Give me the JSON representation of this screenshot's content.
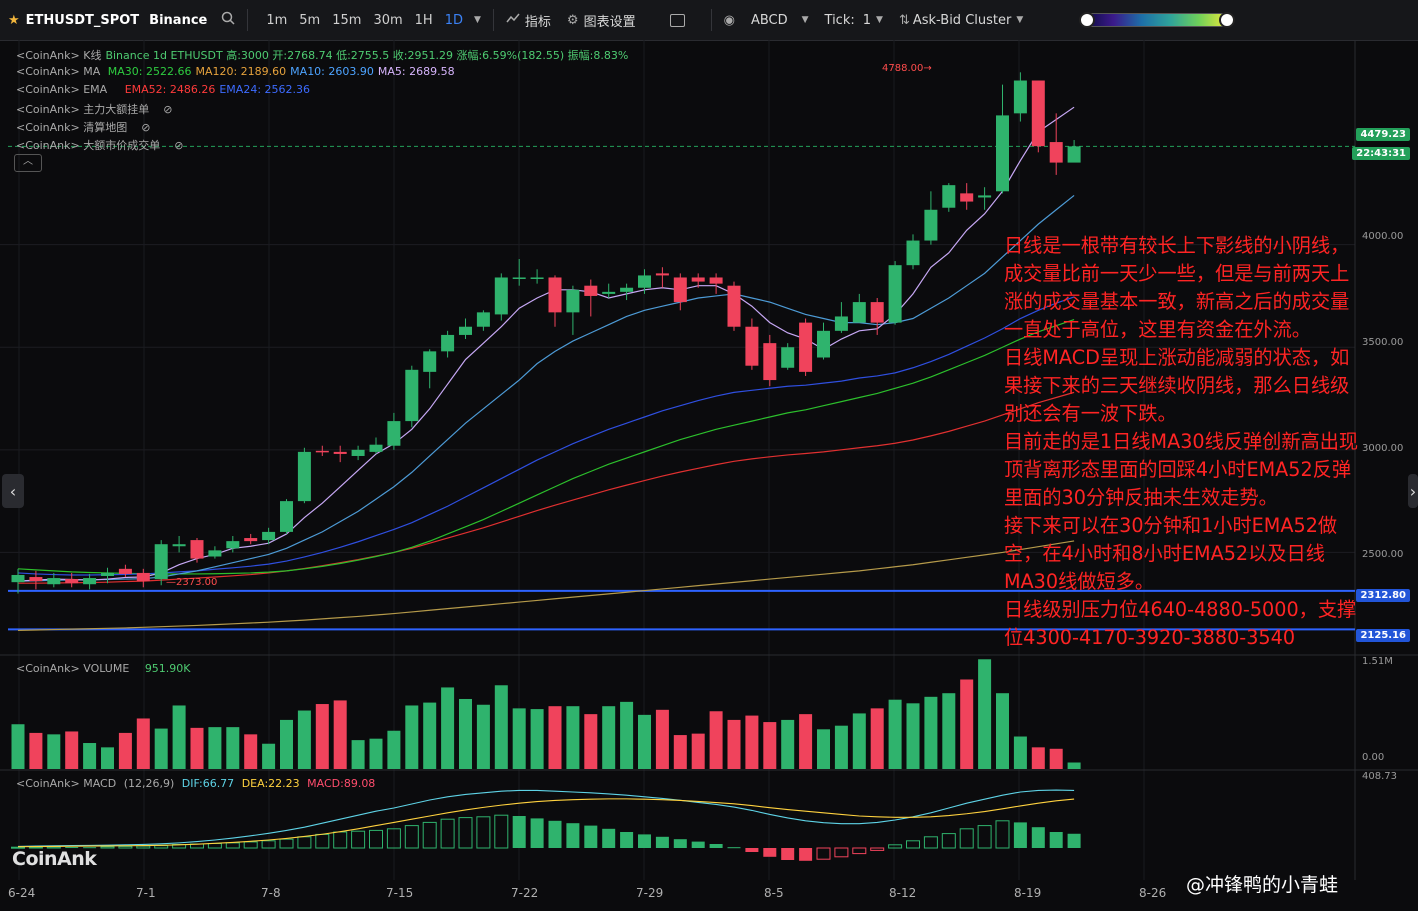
{
  "toolbar": {
    "symbol": "ETHUSDT_SPOT",
    "exchange": "Binance",
    "intervals": [
      "1m",
      "5m",
      "15m",
      "30m",
      "1H",
      "1D"
    ],
    "active_interval": "1D",
    "indicators_label": "指标",
    "chart_settings_label": "图表设置",
    "abcd_label": "ABCD",
    "tick_label": "Tick:",
    "tick_value": "1",
    "cluster_label": "Ask-Bid Cluster"
  },
  "legends": {
    "kline": {
      "prefix": "<CoinAnk> K线",
      "text": "Binance 1d ETHUSDT 高:3000 开:2768.74 低:2755.5 收:2951.29 涨幅:6.59%(182.55) 振幅:8.83%",
      "color": "#4ecb71"
    },
    "ma": {
      "prefix": "<CoinAnk> MA",
      "items": [
        {
          "text": "MA30: 2522.66",
          "color": "#2ecc40"
        },
        {
          "text": "MA120: 2189.60",
          "color": "#e6a23c"
        },
        {
          "text": "MA10: 2603.90",
          "color": "#2f80ed"
        },
        {
          "text": "MA5: 2689.58",
          "color": "#d6b4fc"
        }
      ]
    },
    "ema": {
      "prefix": "<CoinAnk> EMA",
      "items": [
        {
          "text": "EMA52: 2486.26",
          "color": "#ff3b3b"
        },
        {
          "text": "EMA24: 2562.36",
          "color": "#2f5bff"
        }
      ]
    },
    "l4": "<CoinAnk> 主力大额挂单",
    "l5": "<CoinAnk> 清算地图",
    "l6": "<CoinAnk> 大额市价成交单",
    "volume": {
      "prefix": "<CoinAnk> VOLUME",
      "value": "951.90K"
    },
    "macd": {
      "prefix": "<CoinAnk> MACD",
      "params": "(12,26,9)",
      "dif": "DIF:66.77",
      "dea": "DEA:22.23",
      "macd": "MACD:89.08"
    }
  },
  "price_tags": {
    "last_price": "4479.23",
    "countdown": "22:43:31",
    "line1": "2312.80",
    "line2": "2125.16"
  },
  "annotations": {
    "high": "4788.00",
    "low": "2373.00"
  },
  "price_axis": [
    "4000.00",
    "3500.00",
    "3000.00",
    "2500.00"
  ],
  "volume_axis": [
    "1.51M",
    "0.00"
  ],
  "macd_axis": [
    "408.73"
  ],
  "dates": [
    "6-24",
    "7-1",
    "7-8",
    "7-15",
    "7-22",
    "7-29",
    "8-5",
    "8-12",
    "8-19",
    "8-26"
  ],
  "note_paragraphs": [
    "日线是一根带有较长上下影线的小阴线，成交量比前一天少一些，但是与前两天上涨的成交量基本一致，新高之后的成交量一直处于高位，这里有资金在外流。",
    "日线MACD呈现上涨动能减弱的状态，如果接下来的三天继续收阴线，那么日线级别还会有一波下跌。",
    "目前走的是1日线MA30线反弹创新高出现顶背离形态里面的回踩4小时EMA52反弹里面的30分钟反抽未生效走势。",
    "接下来可以在30分钟和1小时EMA52做空，在4小时和8小时EMA52以及日线MA30线做短多。",
    "日线级别压力位4640-4880-5000，支撑位4300-4170-3920-3880-3540"
  ],
  "watermark": "CoinAnk",
  "signature": "@冲锋鸭的小青蛙",
  "chart_data": {
    "type": "candlestick",
    "price_range": [
      2000,
      4900
    ],
    "candles": [
      [
        2355,
        2390,
        2420,
        2300
      ],
      [
        2380,
        2360,
        2410,
        2320
      ],
      [
        2345,
        2375,
        2400,
        2330
      ],
      [
        2370,
        2350,
        2400,
        2330
      ],
      [
        2345,
        2375,
        2395,
        2320
      ],
      [
        2385,
        2400,
        2425,
        2350
      ],
      [
        2420,
        2395,
        2440,
        2380
      ],
      [
        2400,
        2360,
        2420,
        2330
      ],
      [
        2370,
        2540,
        2560,
        2340
      ],
      [
        2530,
        2540,
        2580,
        2500
      ],
      [
        2560,
        2470,
        2570,
        2450
      ],
      [
        2480,
        2510,
        2530,
        2470
      ],
      [
        2520,
        2555,
        2580,
        2500
      ],
      [
        2570,
        2555,
        2590,
        2540
      ],
      [
        2560,
        2600,
        2620,
        2540
      ],
      [
        2600,
        2750,
        2760,
        2590
      ],
      [
        2750,
        2990,
        3010,
        2740
      ],
      [
        2995,
        2990,
        3020,
        2970
      ],
      [
        2990,
        2980,
        3020,
        2940
      ],
      [
        2970,
        3000,
        3020,
        2950
      ],
      [
        2990,
        3025,
        3060,
        2980
      ],
      [
        3020,
        3140,
        3180,
        3000
      ],
      [
        3140,
        3390,
        3410,
        3110
      ],
      [
        3380,
        3480,
        3490,
        3300
      ],
      [
        3480,
        3560,
        3580,
        3450
      ],
      [
        3560,
        3600,
        3640,
        3540
      ],
      [
        3600,
        3670,
        3680,
        3580
      ],
      [
        3660,
        3840,
        3860,
        3630
      ],
      [
        3840,
        3840,
        3930,
        3800
      ],
      [
        3840,
        3840,
        3880,
        3810
      ],
      [
        3840,
        3670,
        3850,
        3600
      ],
      [
        3670,
        3780,
        3800,
        3560
      ],
      [
        3800,
        3750,
        3830,
        3650
      ],
      [
        3760,
        3770,
        3810,
        3740
      ],
      [
        3770,
        3790,
        3810,
        3730
      ],
      [
        3790,
        3850,
        3880,
        3760
      ],
      [
        3860,
        3850,
        3890,
        3790
      ],
      [
        3840,
        3720,
        3860,
        3680
      ],
      [
        3840,
        3820,
        3860,
        3790
      ],
      [
        3840,
        3810,
        3860,
        3760
      ],
      [
        3800,
        3600,
        3820,
        3580
      ],
      [
        3600,
        3410,
        3640,
        3390
      ],
      [
        3520,
        3340,
        3560,
        3310
      ],
      [
        3400,
        3500,
        3520,
        3390
      ],
      [
        3620,
        3380,
        3640,
        3360
      ],
      [
        3450,
        3580,
        3620,
        3440
      ],
      [
        3580,
        3650,
        3720,
        3570
      ],
      [
        3620,
        3720,
        3760,
        3620
      ],
      [
        3720,
        3620,
        3740,
        3560
      ],
      [
        3620,
        3900,
        3920,
        3610
      ],
      [
        3900,
        4020,
        4050,
        3880
      ],
      [
        4020,
        4170,
        4260,
        4000
      ],
      [
        4180,
        4290,
        4300,
        4160
      ],
      [
        4250,
        4210,
        4300,
        4170
      ],
      [
        4230,
        4240,
        4280,
        4170
      ],
      [
        4260,
        4630,
        4780,
        4250
      ],
      [
        4640,
        4800,
        4840,
        4600
      ],
      [
        4800,
        4480,
        4800,
        4450
      ],
      [
        4500,
        4400,
        4640,
        4340
      ],
      [
        4400,
        4479,
        4510,
        4420
      ]
    ],
    "ma5": [
      2360,
      2365,
      2370,
      2368,
      2365,
      2370,
      2378,
      2380,
      2400,
      2440,
      2470,
      2490,
      2520,
      2530,
      2545,
      2590,
      2670,
      2740,
      2820,
      2900,
      2980,
      3030,
      3100,
      3200,
      3320,
      3440,
      3520,
      3600,
      3690,
      3740,
      3780,
      3780,
      3770,
      3740,
      3760,
      3780,
      3790,
      3780,
      3800,
      3800,
      3760,
      3700,
      3620,
      3570,
      3540,
      3490,
      3540,
      3580,
      3590,
      3660,
      3760,
      3890,
      3960,
      4070,
      4150,
      4260,
      4410,
      4550,
      4610,
      4670
    ],
    "ma10": [
      2360,
      2362,
      2364,
      2366,
      2367,
      2368,
      2370,
      2372,
      2380,
      2395,
      2410,
      2430,
      2450,
      2470,
      2490,
      2520,
      2560,
      2600,
      2650,
      2700,
      2760,
      2820,
      2890,
      2970,
      3050,
      3130,
      3200,
      3270,
      3340,
      3420,
      3480,
      3530,
      3570,
      3610,
      3650,
      3680,
      3700,
      3720,
      3740,
      3750,
      3760,
      3740,
      3720,
      3690,
      3660,
      3640,
      3620,
      3620,
      3610,
      3620,
      3640,
      3690,
      3740,
      3800,
      3860,
      3940,
      4020,
      4100,
      4170,
      4240
    ],
    "ema24": [
      2400,
      2395,
      2392,
      2390,
      2390,
      2391,
      2393,
      2395,
      2400,
      2405,
      2410,
      2418,
      2425,
      2433,
      2443,
      2458,
      2478,
      2500,
      2525,
      2552,
      2582,
      2612,
      2645,
      2685,
      2725,
      2770,
      2815,
      2860,
      2905,
      2950,
      2990,
      3030,
      3065,
      3100,
      3130,
      3160,
      3190,
      3215,
      3240,
      3262,
      3280,
      3290,
      3300,
      3310,
      3315,
      3325,
      3335,
      3350,
      3360,
      3375,
      3400,
      3430,
      3465,
      3505,
      3545,
      3590,
      3640,
      3680,
      3715,
      3745
    ],
    "ma30": [
      2420,
      2415,
      2410,
      2405,
      2402,
      2400,
      2398,
      2396,
      2395,
      2395,
      2395,
      2396,
      2398,
      2400,
      2404,
      2410,
      2420,
      2432,
      2446,
      2462,
      2480,
      2500,
      2525,
      2555,
      2590,
      2625,
      2660,
      2700,
      2740,
      2780,
      2820,
      2860,
      2895,
      2930,
      2960,
      2990,
      3020,
      3050,
      3075,
      3100,
      3120,
      3140,
      3160,
      3180,
      3195,
      3215,
      3235,
      3255,
      3275,
      3300,
      3325,
      3355,
      3390,
      3425,
      3460,
      3500,
      3540,
      3575,
      3605,
      3635
    ],
    "ema52": [
      2350,
      2350,
      2351,
      2352,
      2353,
      2355,
      2358,
      2360,
      2365,
      2370,
      2375,
      2380,
      2386,
      2392,
      2400,
      2410,
      2422,
      2435,
      2450,
      2465,
      2482,
      2500,
      2520,
      2545,
      2570,
      2595,
      2620,
      2648,
      2676,
      2704,
      2730,
      2755,
      2780,
      2805,
      2828,
      2850,
      2872,
      2892,
      2910,
      2928,
      2944,
      2956,
      2966,
      2975,
      2982,
      2990,
      3000,
      3010,
      3020,
      3032,
      3048,
      3068,
      3090,
      3115,
      3140,
      3170,
      3200,
      3230,
      3255,
      3280
    ],
    "ma120": [
      2120,
      2122,
      2124,
      2126,
      2128,
      2130,
      2132,
      2135,
      2138,
      2141,
      2144,
      2148,
      2152,
      2156,
      2160,
      2165,
      2170,
      2176,
      2182,
      2188,
      2195,
      2202,
      2210,
      2218,
      2226,
      2234,
      2242,
      2250,
      2258,
      2266,
      2274,
      2282,
      2290,
      2298,
      2306,
      2314,
      2322,
      2330,
      2338,
      2346,
      2354,
      2362,
      2370,
      2378,
      2386,
      2394,
      2402,
      2410,
      2420,
      2430,
      2440,
      2452,
      2464,
      2476,
      2488,
      2500,
      2514,
      2528,
      2542,
      2556
    ],
    "horizontal_levels": [
      2312.8,
      2125.16
    ],
    "volume": [
      0.62,
      0.5,
      0.48,
      0.52,
      0.36,
      0.3,
      0.5,
      0.7,
      0.56,
      0.88,
      0.57,
      0.58,
      0.58,
      0.48,
      0.35,
      0.68,
      0.81,
      0.9,
      0.95,
      0.4,
      0.42,
      0.53,
      0.88,
      0.92,
      1.13,
      0.97,
      0.89,
      1.16,
      0.84,
      0.83,
      0.87,
      0.87,
      0.76,
      0.87,
      0.93,
      0.75,
      0.82,
      0.47,
      0.49,
      0.8,
      0.68,
      0.74,
      0.65,
      0.68,
      0.76,
      0.55,
      0.6,
      0.77,
      0.84,
      0.96,
      0.91,
      1.0,
      1.05,
      1.24,
      1.52,
      1.05,
      0.45,
      0.3,
      0.28,
      0.09
    ],
    "macd_hist": [
      5,
      6,
      7,
      6,
      5,
      8,
      10,
      12,
      15,
      22,
      25,
      28,
      32,
      38,
      45,
      55,
      70,
      85,
      100,
      105,
      110,
      120,
      140,
      160,
      180,
      190,
      195,
      205,
      200,
      185,
      170,
      155,
      140,
      120,
      100,
      85,
      70,
      55,
      40,
      25,
      5,
      -25,
      -55,
      -75,
      -80,
      -70,
      -55,
      -35,
      -15,
      20,
      45,
      70,
      90,
      120,
      140,
      170,
      160,
      130,
      100,
      89
    ],
    "dif": [
      10,
      12,
      14,
      15,
      16,
      18,
      20,
      22,
      26,
      32,
      40,
      50,
      62,
      76,
      92,
      110,
      130,
      155,
      180,
      205,
      230,
      250,
      275,
      300,
      320,
      335,
      345,
      355,
      360,
      360,
      355,
      350,
      345,
      338,
      330,
      320,
      310,
      298,
      285,
      272,
      256,
      235,
      210,
      188,
      170,
      158,
      152,
      152,
      160,
      175,
      195,
      220,
      250,
      280,
      305,
      330,
      350,
      360,
      362,
      360
    ],
    "dea": [
      8,
      9,
      10,
      11,
      12,
      13,
      14,
      15,
      17,
      20,
      24,
      29,
      35,
      42,
      50,
      60,
      72,
      86,
      102,
      120,
      140,
      160,
      180,
      200,
      220,
      238,
      254,
      268,
      280,
      290,
      297,
      302,
      305,
      307,
      307,
      305,
      302,
      297,
      291,
      284,
      276,
      265,
      252,
      240,
      230,
      220,
      210,
      200,
      195,
      192,
      192,
      195,
      203,
      214,
      228,
      245,
      263,
      280,
      295,
      306
    ]
  }
}
